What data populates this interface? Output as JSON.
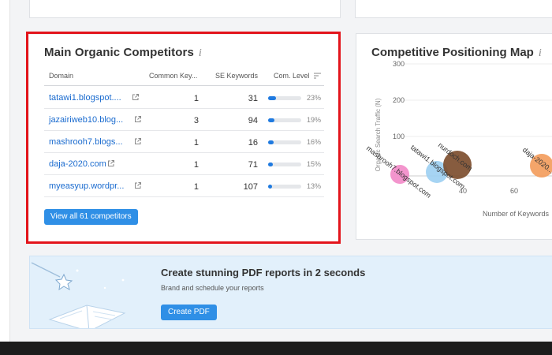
{
  "competitors": {
    "title": "Main Organic Competitors",
    "info_glyph": "i",
    "columns": [
      "Domain",
      "Common Key...",
      "SE Keywords",
      "Com. Level"
    ],
    "rows": [
      {
        "domain": "tatawi1.blogspot....",
        "common": "1",
        "se": "31",
        "level": "23%",
        "level_value": 0.23
      },
      {
        "domain": "jazairiweb10.blog...",
        "common": "3",
        "se": "94",
        "level": "19%",
        "level_value": 0.19
      },
      {
        "domain": "mashrooh7.blogs...",
        "common": "1",
        "se": "16",
        "level": "16%",
        "level_value": 0.16
      },
      {
        "domain": "daja-2020.com",
        "common": "1",
        "se": "71",
        "level": "15%",
        "level_value": 0.15
      },
      {
        "domain": "myeasyup.wordpr...",
        "common": "1",
        "se": "107",
        "level": "13%",
        "level_value": 0.13
      }
    ],
    "view_all": "View all 61 competitors"
  },
  "map": {
    "title": "Competitive Positioning Map",
    "info_glyph": "i",
    "y_label": "Organic Search Traffic (N)",
    "x_label": "Number of Keywords",
    "y_ticks": [
      "300",
      "200",
      "100"
    ],
    "x_ticks": [
      "40",
      "60"
    ],
    "bubble_labels": [
      "mashrooh7.blogspot.com",
      "tatawi1.blogspot.com",
      "nurdoch.com",
      "daja-2020..."
    ]
  },
  "pdf": {
    "title": "Create stunning PDF reports in 2 seconds",
    "subtitle": "Brand and schedule your reports",
    "button": "Create PDF"
  },
  "colors": {
    "accent": "#2f8fe6",
    "link": "#1a6bcf",
    "highlight": "#e3141b",
    "bar": "#1f7ae0"
  }
}
